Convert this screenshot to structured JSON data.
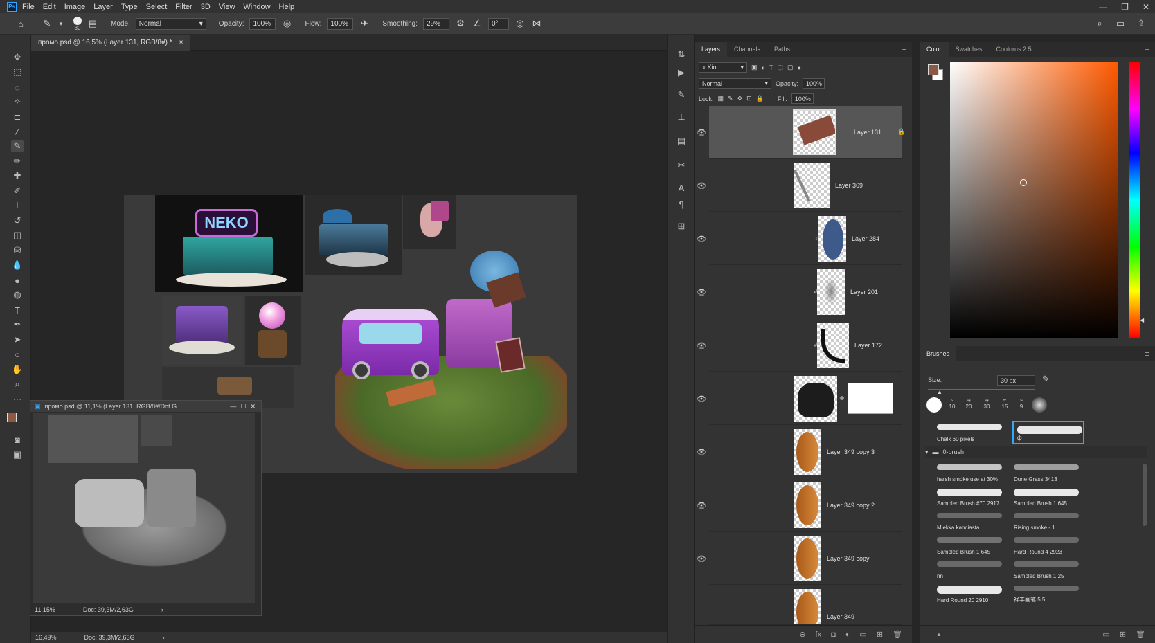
{
  "menubar": {
    "app_icon": "Ps",
    "items": [
      "File",
      "Edit",
      "Image",
      "Layer",
      "Type",
      "Select",
      "Filter",
      "3D",
      "View",
      "Window",
      "Help"
    ]
  },
  "options_bar": {
    "brush_size": "30",
    "mode_label": "Mode:",
    "mode_value": "Normal",
    "opacity_label": "Opacity:",
    "opacity_value": "100%",
    "flow_label": "Flow:",
    "flow_value": "100%",
    "smoothing_label": "Smoothing:",
    "smoothing_value": "29%",
    "angle_value": "0°"
  },
  "document": {
    "tab_title": "промо.psd @ 16,5% (Layer 131, RGB/8#) *",
    "tab_close": "×",
    "status_zoom": "16,49%",
    "status_doc": "Doc: 39,3M/2,63G",
    "status_arrow": "›"
  },
  "subwindow": {
    "title": "промо.psd @ 11,1% (Layer 131, RGB/8#/Dot G...",
    "zoom": "11,15%",
    "doc": "Doc: 39,3M/2,63G",
    "arrow": "›",
    "minimize": "—",
    "maximize": "☐",
    "close": "✕"
  },
  "artwork": {
    "neko_sign": "NEKO"
  },
  "layers_panel": {
    "tabs": [
      "Layers",
      "Channels",
      "Paths"
    ],
    "filter_kind": "Kind",
    "blend_mode": "Normal",
    "opacity_label": "Opacity:",
    "opacity_value": "100%",
    "lock_label": "Lock:",
    "fill_label": "Fill:",
    "fill_value": "100%",
    "layers": [
      {
        "name": "Layer 131"
      },
      {
        "name": "Layer 369"
      },
      {
        "name": "Layer 284"
      },
      {
        "name": "Layer 201"
      },
      {
        "name": "Layer 172"
      },
      {
        "name": ""
      },
      {
        "name": "Layer 349 copy 3"
      },
      {
        "name": "Layer 349 copy 2"
      },
      {
        "name": "Layer 349 copy"
      },
      {
        "name": "Layer 349"
      }
    ]
  },
  "color_panel": {
    "tabs": [
      "Color",
      "Swatches",
      "Coolorus 2.5"
    ],
    "foreground": "#8a5a44",
    "hue_color": "#ff5a00"
  },
  "brushes_panel": {
    "title": "Brushes",
    "size_label": "Size:",
    "size_value": "30 px",
    "preset_sizes": [
      "10",
      "20",
      "30",
      "15",
      "9"
    ],
    "selected_brushes": [
      "Chalk 60 pixels",
      "ф"
    ],
    "group_name": "0-brush",
    "brushes": [
      "harsh smoke use at 30%",
      "Dune Grass 3413",
      "Sampled Brush #70 2917",
      "Sampled Brush 1 645",
      "Miekka kanciasta",
      "Rising smoke - 1",
      "Sampled Brush 1 645",
      "Hard Round 4 2923",
      "ññ",
      "Sampled Brush 1 25",
      "Hard Round 20 2910",
      "祥丰画笔 5 5"
    ]
  }
}
